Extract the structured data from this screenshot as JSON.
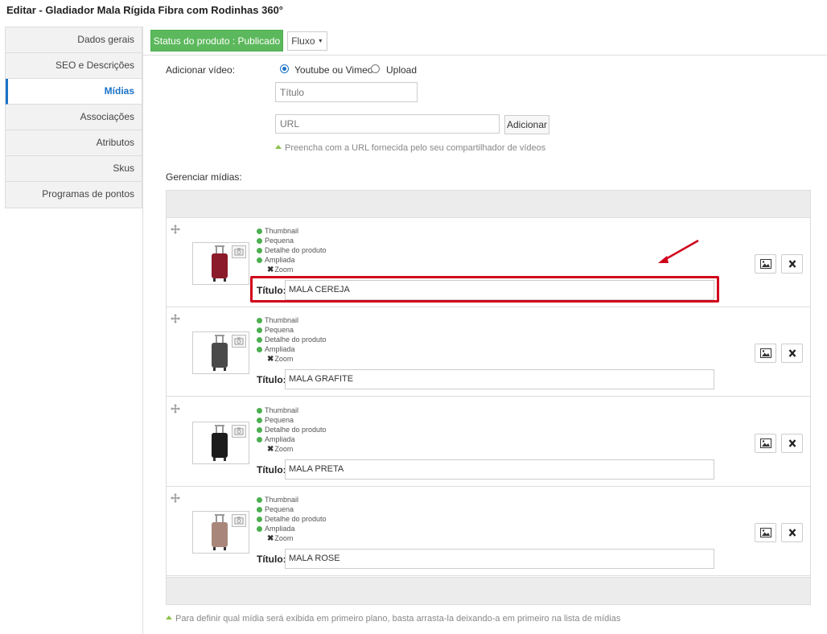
{
  "page": {
    "title": "Editar - Gladiador Mala Rígida Fibra com Rodinhas 360°"
  },
  "sidebar": {
    "items": [
      {
        "label": "Dados gerais",
        "active": false
      },
      {
        "label": "SEO e Descrições",
        "active": false
      },
      {
        "label": "Mídias",
        "active": true
      },
      {
        "label": "Associações",
        "active": false
      },
      {
        "label": "Atributos",
        "active": false
      },
      {
        "label": "Skus",
        "active": false
      },
      {
        "label": "Programas de pontos",
        "active": false
      }
    ]
  },
  "toolbar": {
    "status_label": "Status do produto : Publicado",
    "flow_label": "Fluxo",
    "status_color": "#5cb85c"
  },
  "video": {
    "label": "Adicionar vídeo:",
    "option_youtube": "Youtube ou Vimeo",
    "option_upload": "Upload",
    "selected": "Youtube ou Vimeo",
    "title_placeholder": "Título",
    "url_placeholder": "URL",
    "add_label": "Adicionar",
    "hint": "Preencha com a URL fornecida pelo seu compartilhador de vídeos"
  },
  "media": {
    "label": "Gerenciar mídias:",
    "title_label": "Título:",
    "sizes": [
      "Thumbnail",
      "Pequena",
      "Detalhe do produto",
      "Ampliada"
    ],
    "zoom_label": "Zoom",
    "items": [
      {
        "title": "MALA CEREJA",
        "color": "#8b1a2b"
      },
      {
        "title": "MALA GRAFITE",
        "color": "#4a4a4a"
      },
      {
        "title": "MALA PRETA",
        "color": "#1c1c1c"
      },
      {
        "title": "MALA ROSE",
        "color": "#a8877a"
      }
    ],
    "hint": "Para definir qual mídia será exibida em primeiro plano, basta arrasta-la deixando-a em primeiro na lista de mídias"
  },
  "annotation": {
    "color": "#d0021b"
  }
}
